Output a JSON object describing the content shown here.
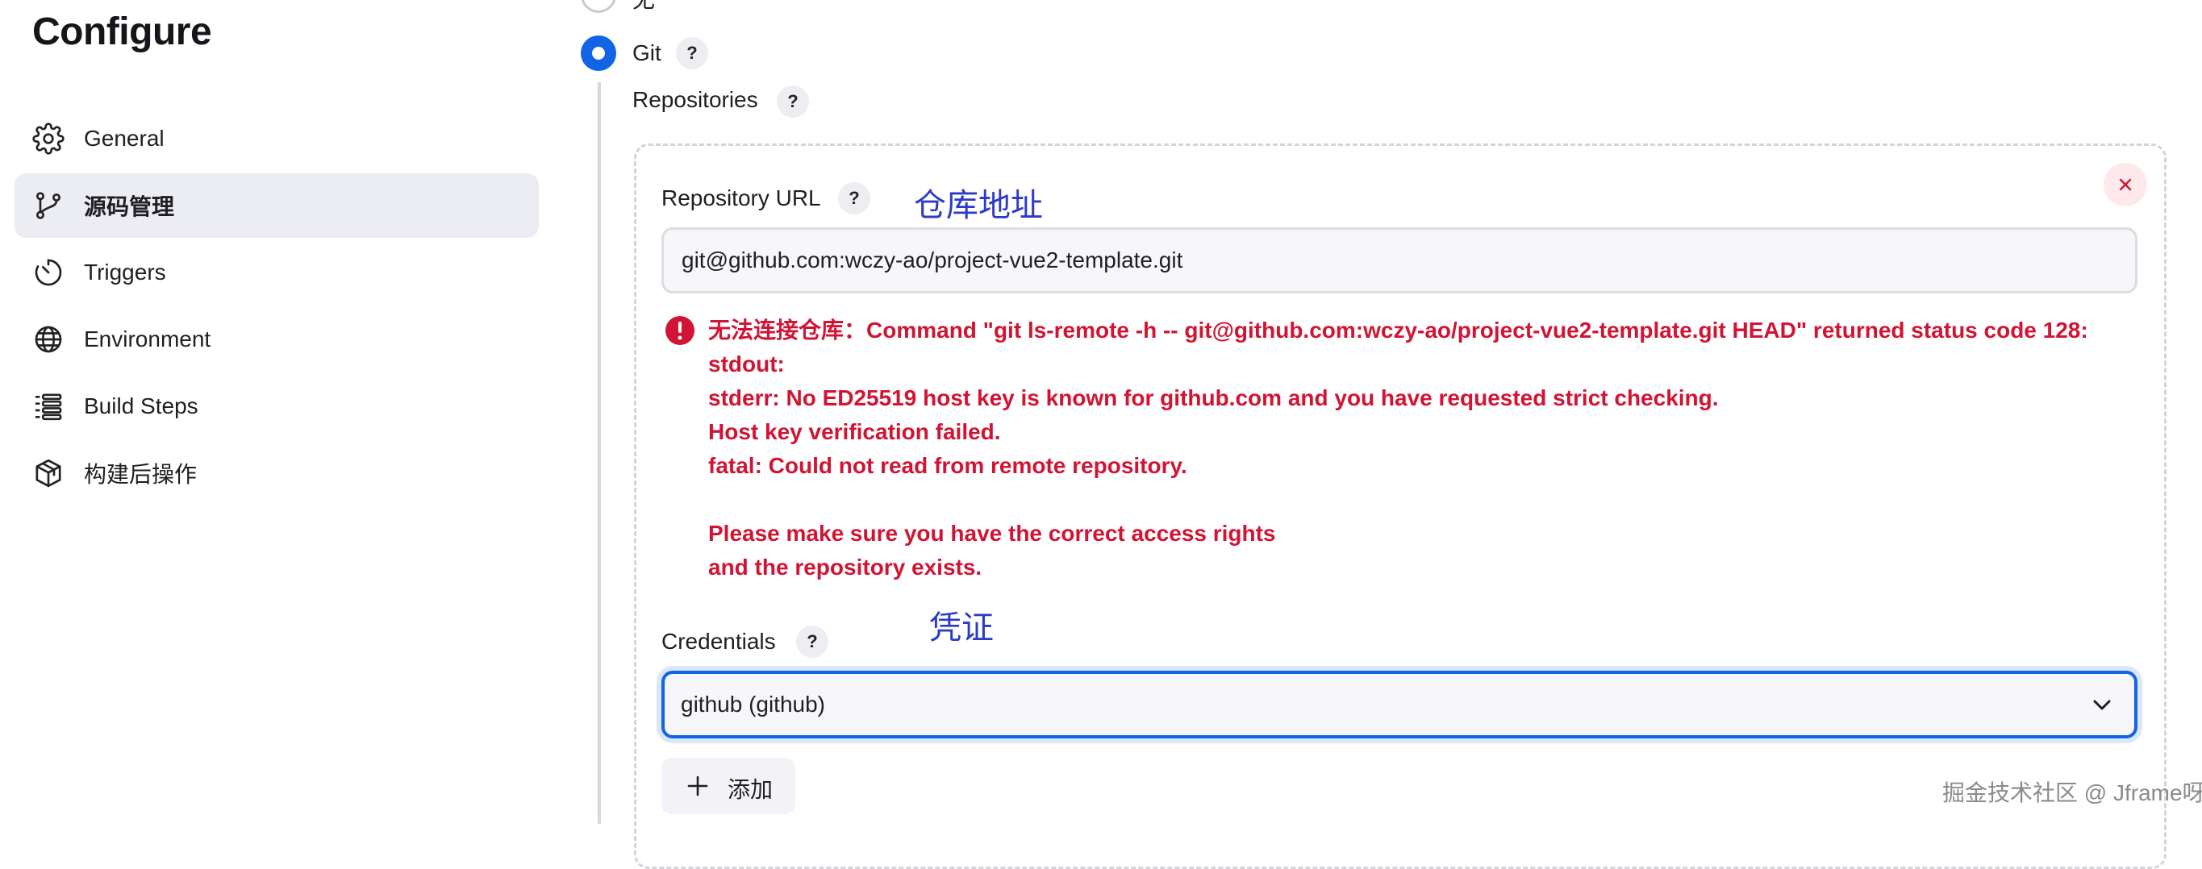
{
  "sidebar": {
    "title": "Configure",
    "items": [
      {
        "label": "General",
        "icon": "gear-icon",
        "active": false
      },
      {
        "label": "源码管理",
        "icon": "git-branch-icon",
        "active": true
      },
      {
        "label": "Triggers",
        "icon": "clock-icon",
        "active": false
      },
      {
        "label": "Environment",
        "icon": "globe-icon",
        "active": false
      },
      {
        "label": "Build Steps",
        "icon": "list-icon",
        "active": false
      },
      {
        "label": "构建后操作",
        "icon": "package-icon",
        "active": false
      }
    ]
  },
  "scm": {
    "option_none_label": "无",
    "option_git_label": "Git",
    "help_label": "?",
    "repositories_label": "Repositories",
    "repository_url_label": "Repository URL",
    "repository_url_value": "git@github.com:wczy-ao/project-vue2-template.git",
    "error_lines": [
      "无法连接仓库：Command \"git ls-remote -h -- git@github.com:wczy-ao/project-vue2-template.git HEAD\" returned status code 128:",
      "stdout:",
      "stderr: No ED25519 host key is known for github.com and you have requested strict checking.",
      "Host key verification failed.",
      "fatal: Could not read from remote repository.",
      "",
      "Please make sure you have the correct access rights",
      "and the repository exists."
    ],
    "credentials_label": "Credentials",
    "credentials_value": "github (github)",
    "add_button_label": "添加"
  },
  "annotations": {
    "repo_address": "仓库地址",
    "credentials": "凭证"
  },
  "watermark": "掘金技术社区 @ Jframe呀",
  "colors": {
    "accent": "#1064e5",
    "error": "#d21434",
    "annotation": "#2b3bc7",
    "active_nav_bg": "#ececf3"
  }
}
